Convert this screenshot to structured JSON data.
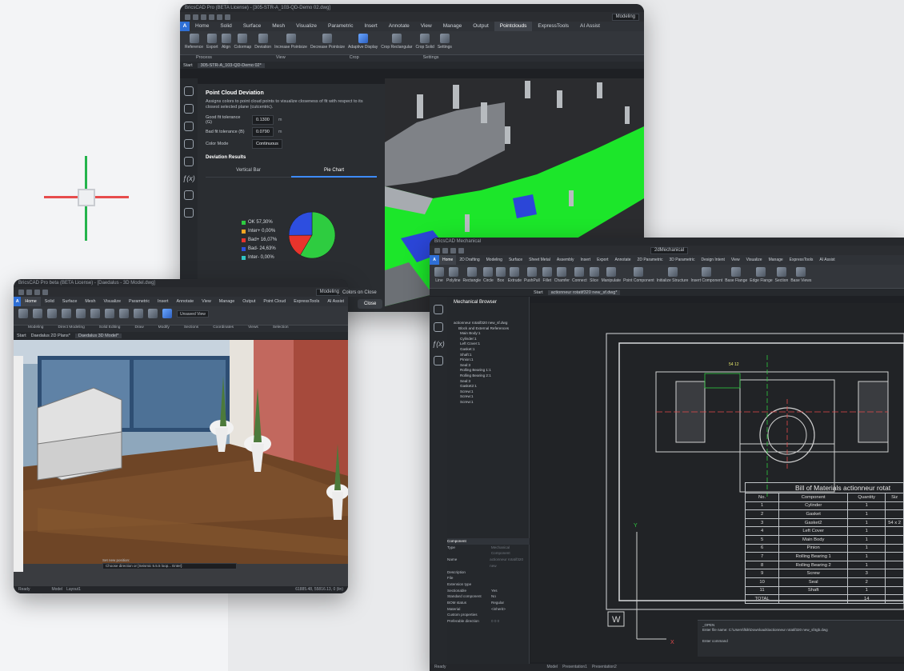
{
  "accent": "#2e6fd6",
  "win1": {
    "title": "BricsCAD Pro (BETA License) - [305-STR-A_103-QD-Demo 02.dwg]",
    "workspace": "Modeling",
    "tabs": [
      "Home",
      "Solid",
      "Surface",
      "Mesh",
      "Visualize",
      "Parametric",
      "Insert",
      "Annotate",
      "View",
      "Manage",
      "Output",
      "Pointclouds",
      "ExpressTools",
      "AI Assist"
    ],
    "ribbon": [
      "Reference",
      "Export",
      "Align",
      "Colormap",
      "Deviation",
      "Increase Pointsize",
      "Decrease Pointsize",
      "Adaptive Display",
      "Crop Rectangular",
      "Crop Solid",
      "Settings"
    ],
    "groups": [
      "Process",
      "View",
      "Crop",
      "Settings"
    ],
    "doc_tab": "305-STR-A_103-QD-Demo 02*",
    "start_tab": "Start",
    "panel": {
      "title": "Point Cloud Deviation",
      "desc": "Assigns colors to point cloud points to visualize closeness of fit with respect to its closest selected plane (cutcentric).",
      "good_label": "Good fit tolerance (G)",
      "good_value": "0.1300",
      "good_unit": "m",
      "bad_label": "Bad fit tolerance (B)",
      "bad_value": "0.0790",
      "bad_unit": "m",
      "mode_label": "Color Mode",
      "mode_value": "Continuous",
      "results": "Deviation Results",
      "tab1": "Vertical Bar",
      "tab2": "Pie Chart",
      "legend": [
        "OK 57,30%",
        "Inter+ 0,00%",
        "Bad+ 16,07%",
        "Bad- 24,63%",
        "Inter- 0,00%"
      ],
      "colors_on_close": "Colors on Close",
      "close": "Close"
    }
  },
  "chart_data": {
    "type": "pie",
    "categories": [
      "OK",
      "Inter+",
      "Bad+",
      "Bad-",
      "Inter-"
    ],
    "values": [
      57.3,
      0.0,
      16.07,
      24.63,
      0.0
    ],
    "colors": [
      "#2ecc40",
      "#f5a623",
      "#e8342c",
      "#2d4ee0",
      "#30c4c4"
    ]
  },
  "win2": {
    "title": "BricsCAD Pro beta (BETA License) - [Daedalus - 3D Model.dwg]",
    "workspace": "Modeling",
    "tabs": [
      "Home",
      "Solid",
      "Surface",
      "Mesh",
      "Visualize",
      "Parametric",
      "Insert",
      "Annotate",
      "View",
      "Manage",
      "Output",
      "Point Cloud",
      "ExpressTools",
      "AI Assist"
    ],
    "groups": [
      "Modeling",
      "Direct Modeling",
      "Solid Editing",
      "Draw",
      "Modify",
      "Sections",
      "Coordinates",
      "Views",
      "Selection"
    ],
    "doc_tabs": [
      "Start",
      "Daedalus 2D Plans*",
      "Daedalus 3D Model*"
    ],
    "view_label": "Unsaved View",
    "prompt": "Set new position:",
    "command": "Choose direction or [Seismic 5.5.5 loop... Enter]:",
    "layout_tabs": [
      "Model",
      "Layout1"
    ],
    "status_left": "Ready",
    "status_right": "61885.48, 55816.13, 0 (lin)"
  },
  "win3": {
    "title": "BricsCAD Mechanical",
    "workspace": "2dMechanical",
    "tabs": [
      "Home",
      "2D Drafting",
      "Modeling",
      "Surface",
      "Sheet Metal",
      "Assembly",
      "Insert",
      "Export",
      "Annotate",
      "2D Parametric",
      "3D Parametric",
      "Design Intent",
      "View",
      "Visualize",
      "Manage",
      "ExpressTools",
      "AI Assist"
    ],
    "ribbon": [
      "Line",
      "Polyline",
      "Rectangle",
      "Circle",
      "Box",
      "Extrude",
      "PushPull",
      "Fillet",
      "Chamfer",
      "Connect",
      "Slice",
      "Manipulate",
      "Point Component",
      "Initialize Structure",
      "Insert Component",
      "Base Flange",
      "Edge Flange",
      "Section",
      "Base Views"
    ],
    "doc_tabs": [
      "Start",
      "actionneur rotatif320 new_sf.dwg*"
    ],
    "browser_title": "Mechanical Browser",
    "tree_root": "actionneur rotatif320 new_sf.dwg",
    "tree": [
      "Block and External References",
      "Main Body:1",
      "Cylinder:1",
      "Left Cover:1",
      "Gasket:1",
      "Shaft:1",
      "Pinion:1",
      "Seal:3",
      "Rolling Bearing 1:1",
      "Rolling Bearing 2:1",
      "Seal:3",
      "Gasket2:1",
      "Screw:1",
      "Screw:1",
      "Screw:1"
    ],
    "props_header": "Component",
    "props": [
      [
        "Type",
        "Mechanical Component"
      ],
      [
        "Name",
        "actionneur rotatif320 new"
      ],
      [
        "Description",
        ""
      ],
      [
        "File",
        ""
      ],
      [
        "Extension type",
        ""
      ],
      [
        "Sectionable",
        "Yes"
      ],
      [
        "Standard component",
        "No"
      ],
      [
        "BOM status",
        "Regular"
      ],
      [
        "Material",
        "<inherit>"
      ],
      [
        "Custom properties",
        ""
      ],
      [
        "Preferable direction",
        "0 0 0"
      ]
    ],
    "bom_title": "Bill of Materials actionneur rotat",
    "bom_headers": [
      "No.",
      "Component",
      "Quantity",
      "Siz"
    ],
    "bom_rows": [
      [
        "1",
        "Cylinder",
        "1",
        ""
      ],
      [
        "2",
        "Gasket",
        "1",
        ""
      ],
      [
        "3",
        "Gasket2",
        "1",
        "54 x 2"
      ],
      [
        "4",
        "Left Cover",
        "1",
        ""
      ],
      [
        "5",
        "Main Body",
        "1",
        ""
      ],
      [
        "6",
        "Pinion",
        "1",
        ""
      ],
      [
        "7",
        "Rolling Bearing 1",
        "1",
        ""
      ],
      [
        "8",
        "Rolling Bearing 2",
        "1",
        ""
      ],
      [
        "9",
        "Screw",
        "3",
        ""
      ],
      [
        "10",
        "Seal",
        "2",
        ""
      ],
      [
        "11",
        "Shaft",
        "1",
        ""
      ],
      [
        "TOTAL",
        "",
        "14",
        ""
      ]
    ],
    "dim_text": "54 12",
    "cmd_lines": [
      "_OPEN",
      "Enter file name: C:\\Users\\fkik\\Downloads\\actionneur rotatif320 new_sf4gb.dwg"
    ],
    "cmd_prompt": "Enter command",
    "w_label": "W",
    "x_label": "X",
    "y_label": "Y",
    "layout_tabs": [
      "Model",
      "Presentation1",
      "Presentation2"
    ],
    "status": "Ready"
  }
}
